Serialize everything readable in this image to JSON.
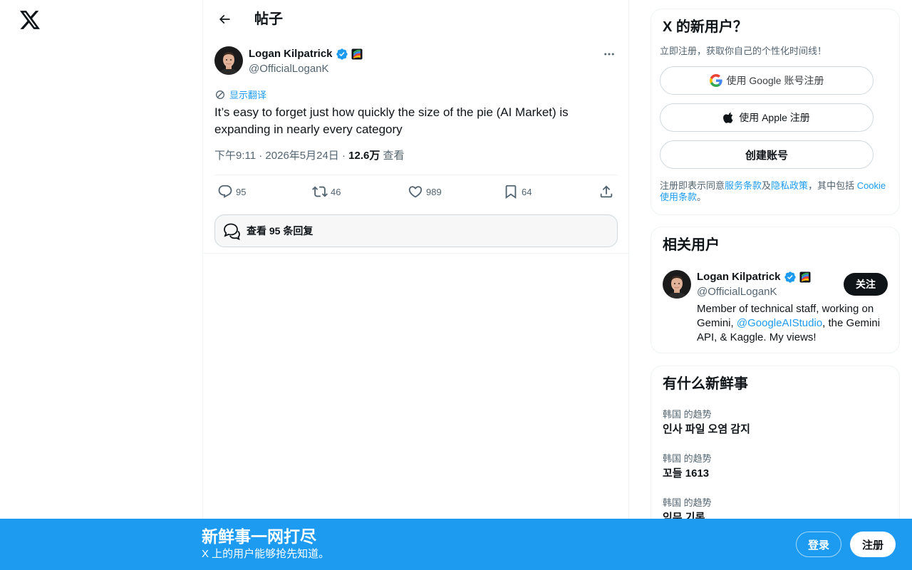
{
  "header": {
    "title": "帖子"
  },
  "post": {
    "author_name": "Logan Kilpatrick",
    "author_handle": "@OfficialLoganK",
    "translate_label": "显示翻译",
    "text": "It’s easy to forget just how quickly the size of the pie (AI Market) is expanding in nearly every category",
    "meta_time": "下午9:11 · 2026年5月24日 · ",
    "views_count": "12.6万",
    "views_label": " 查看",
    "replies": "95",
    "reposts": "46",
    "likes": "989",
    "bookmarks": "64",
    "view_replies_label": "查看 95 条回复"
  },
  "signup": {
    "title": "X 的新用户？",
    "subtitle": "立即注册，获取你自己的个性化时间线！",
    "google_label": "使用 Google 账号注册",
    "apple_label": "使用 Apple 注册",
    "create_label": "创建账号",
    "legal_1": "注册即表示同意",
    "terms_link": "服务条款",
    "legal_2": "及",
    "privacy_link": "隐私政策",
    "legal_3": "，其中包括 ",
    "cookie_link": "Cookie 使用条款",
    "legal_4": "。"
  },
  "related": {
    "title": "相关用户",
    "name": "Logan Kilpatrick",
    "handle": "@OfficialLoganK",
    "follow_label": "关注",
    "bio_1": "Member of technical staff, working on Gemini, ",
    "bio_mention": "@GoogleAIStudio",
    "bio_2": ", the Gemini API, & Kaggle. My views!"
  },
  "trends": {
    "title": "有什么新鲜事",
    "items": [
      {
        "meta": "韩国 的趋势",
        "name": "인사 파일 오염 감지"
      },
      {
        "meta": "韩国 的趋势",
        "name": "꼬들 1613"
      },
      {
        "meta": "韩国 的趋势",
        "name": "임무 기록"
      }
    ]
  },
  "banner": {
    "title": "新鲜事一网打尽",
    "subtitle": "X 上的用户能够抢先知道。",
    "login_label": "登录",
    "signup_label": "注册"
  },
  "colors": {
    "accent": "#1d9bf0",
    "text": "#0f1419",
    "muted": "#536471",
    "verified": "#1d9bf0"
  },
  "icons": [
    "x-logo-icon",
    "back-arrow-icon",
    "verified-badge-icon",
    "affiliate-badge-icon",
    "more-icon",
    "translate-icon",
    "reply-icon",
    "repost-icon",
    "like-icon",
    "bookmark-icon",
    "share-icon",
    "replies-bubble-icon",
    "google-icon",
    "apple-icon"
  ]
}
